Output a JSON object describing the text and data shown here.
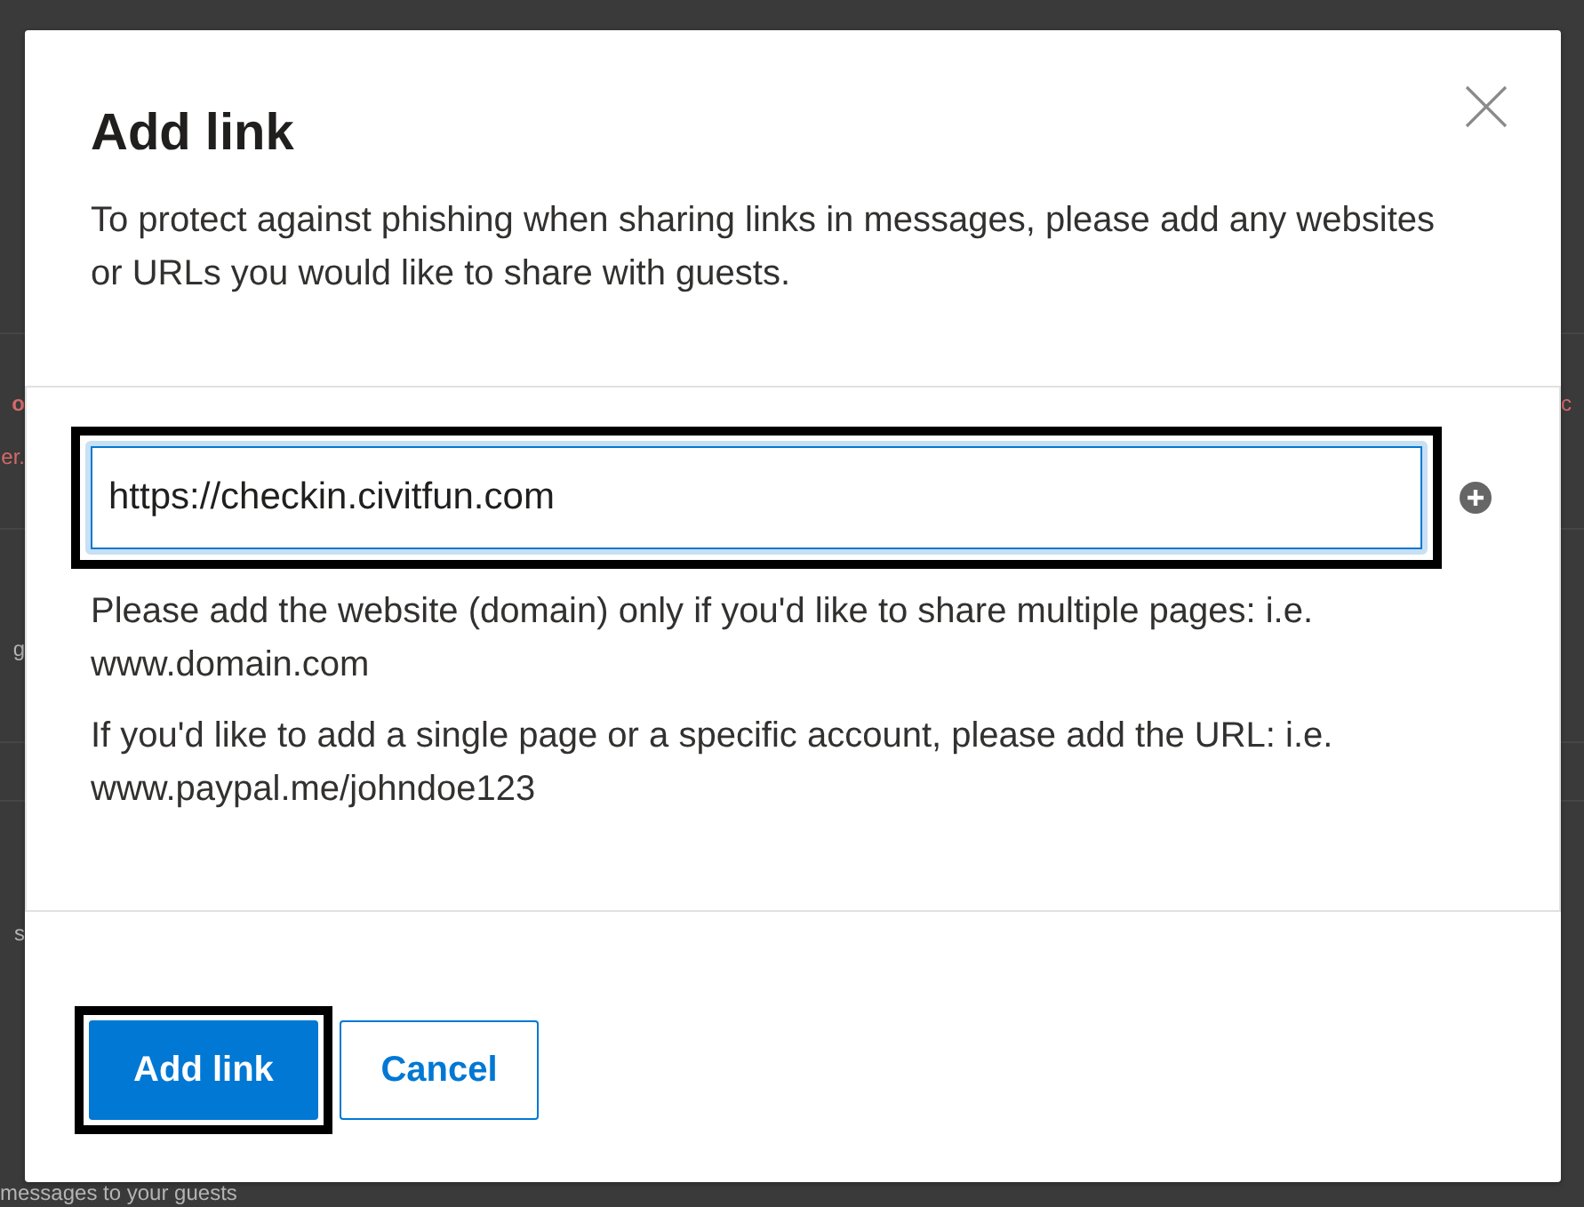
{
  "background_page": {
    "sections": [
      {
        "lines": [
          {
            "kind": "alert-title",
            "text": "o"
          },
          {
            "kind": "alert-text",
            "text": "er."
          }
        ],
        "side_text": "c"
      },
      {
        "lines": [
          {
            "kind": "text",
            "text": "g"
          }
        ]
      },
      {
        "lines": [
          {
            "kind": "text",
            "text": "s"
          }
        ]
      }
    ],
    "bottom_text": "messages to your guests"
  },
  "dialog": {
    "title": "Add link",
    "description": "To protect against phishing when sharing links in messages, please add any websites or URLs you would like to share with guests.",
    "url_field": {
      "value": "https://checkin.civitfun.com",
      "focused": true
    },
    "help_texts": [
      "Please add the website (domain) only if you'd like to share multiple pages: i.e. www.domain.com",
      "If you'd like to add a single page or a specific account, please add the URL: i.e. www.paypal.me/johndoe123"
    ],
    "buttons": [
      {
        "label": "Add link",
        "kind": "primary",
        "focused": true
      },
      {
        "label": "Cancel",
        "kind": "secondary",
        "focused": false
      }
    ]
  }
}
